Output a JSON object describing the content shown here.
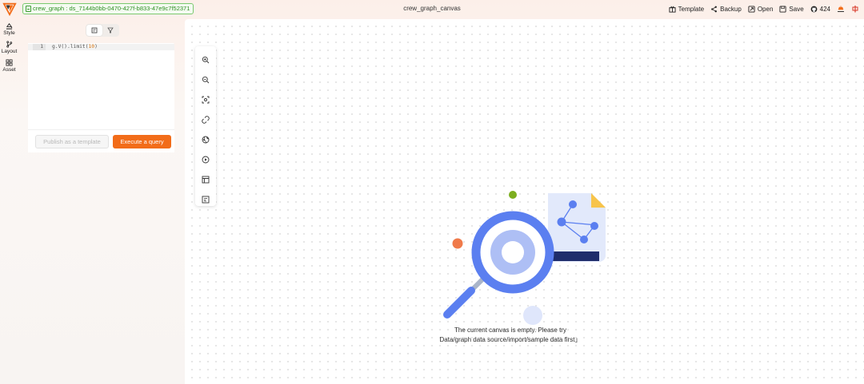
{
  "topbar": {
    "datasource_tag": "crew_graph : ds_7144b0bb-0470-427f-b833-47e9c7f52371",
    "app_title": "crew_graph_canvas",
    "actions": [
      {
        "label": "Template",
        "icon": "template-icon"
      },
      {
        "label": "Backup",
        "icon": "share-icon"
      },
      {
        "label": "Open",
        "icon": "open-icon"
      },
      {
        "label": "Save",
        "icon": "save-icon"
      },
      {
        "label": "424",
        "icon": "github-icon"
      }
    ],
    "extra_icons": [
      "theme-icon",
      "language-zh-icon"
    ]
  },
  "rail": {
    "items": [
      {
        "label": "Style",
        "icon": "style-brush-icon"
      },
      {
        "label": "Layout",
        "icon": "layout-branch-icon"
      },
      {
        "label": "Asset",
        "icon": "asset-grid-icon"
      }
    ]
  },
  "query": {
    "mode_tabs": [
      "query-editor-icon",
      "filter-icon"
    ],
    "line_number": "1",
    "code_prefix": "g.V().limit(",
    "code_number": "10",
    "code_suffix": ")",
    "publish_label": "Publish as a template",
    "execute_label": "Execute a query"
  },
  "canvas": {
    "toolbar_icons": [
      "zoom-in-icon",
      "zoom-out-icon",
      "fit-view-icon",
      "unlink-icon",
      "globe-icon",
      "play-circle-icon",
      "layout-panel-icon",
      "list-icon"
    ],
    "empty_message": "The current canvas is empty. Please try Data/graph data source/import/sample data first」"
  },
  "colors": {
    "accent": "#f26c19",
    "tag_green": "#2f8f24",
    "illustration_blue": "#5b7ff0"
  }
}
